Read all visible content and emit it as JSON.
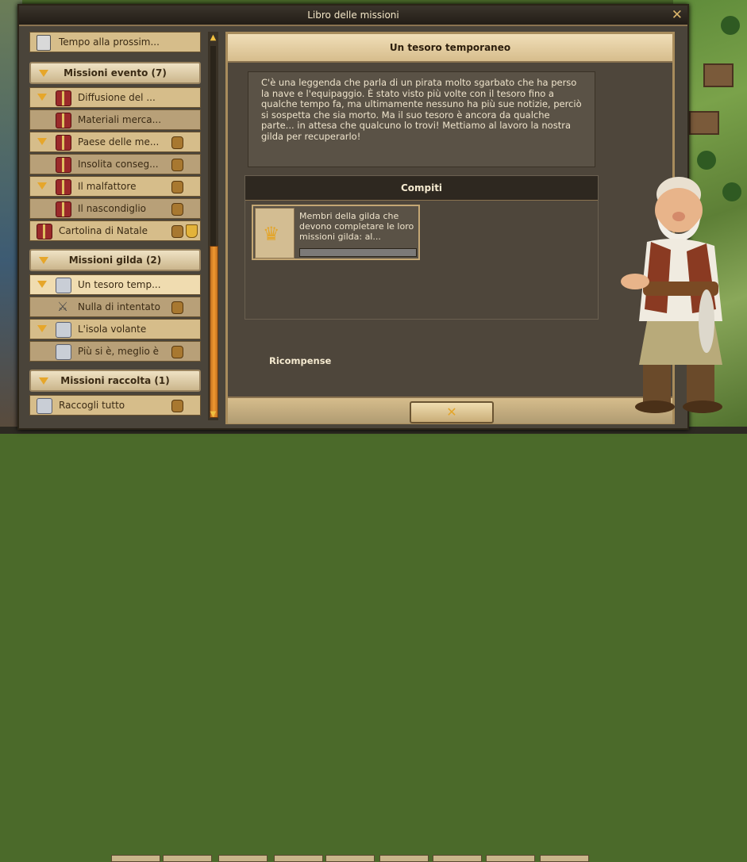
{
  "window": {
    "title": "Libro delle missioni",
    "close_icon": "close-icon"
  },
  "list": {
    "timer_row": {
      "label": "Tempo alla prossim...",
      "icon": "hourglass-icon"
    },
    "groups": [
      {
        "header": "Missioni evento (7)",
        "items": [
          {
            "label": "Diffusione del ...",
            "icon": "gift-icon",
            "expanded": true
          },
          {
            "label": "Materiali merca...",
            "icon": "gift-icon",
            "indent": true
          },
          {
            "label": "Paese delle me...",
            "icon": "gift-icon",
            "expanded": true,
            "reward": "bag-icon"
          },
          {
            "label": "Insolita conseg...",
            "icon": "gift-icon",
            "indent": true,
            "reward": "bag-icon"
          },
          {
            "label": "Il malfattore",
            "icon": "gift-icon",
            "expanded": true,
            "reward": "bag-icon"
          },
          {
            "label": "Il nascondiglio",
            "icon": "gift-icon",
            "indent": true,
            "reward": "bag-icon"
          },
          {
            "label": "Cartolina di Natale",
            "icon": "gift-icon",
            "reward": "bag-icon",
            "reward2": "cup-icon"
          }
        ]
      },
      {
        "header": "Missioni gilda (2)",
        "items": [
          {
            "label": "Un tesoro temp...",
            "icon": "scroll-icon",
            "expanded": true,
            "selected": true
          },
          {
            "label": "Nulla di intentato",
            "icon": "swords-icon",
            "indent": true,
            "reward": "bag-icon"
          },
          {
            "label": "L'isola volante",
            "icon": "scroll-icon",
            "expanded": true
          },
          {
            "label": "Più si è, meglio è",
            "icon": "scroll-icon",
            "indent": true,
            "reward": "bag-icon"
          }
        ]
      },
      {
        "header": "Missioni raccolta (1)",
        "items": [
          {
            "label": "Raccogli tutto",
            "icon": "scroll-icon",
            "reward": "bag-icon"
          }
        ]
      }
    ]
  },
  "detail": {
    "title": "Un tesoro temporaneo",
    "description": "C'è una leggenda che parla di un pirata molto sgarbato che ha perso la nave e l'equipaggio. È stato visto più volte con il tesoro fino a qualche tempo fa, ma ultimamente nessuno ha più sue notizie, perciò si sospetta che sia morto. Ma il suo tesoro è ancora da qualche parte... in attesa che qualcuno lo trovi! Mettiamo al lavoro la nostra gilda per recuperarlo!",
    "tasks_header": "Compiti",
    "task": {
      "text": "Membri della gilda che devono completare le loro missioni gilda: al...",
      "icon": "crown-icon",
      "progress": 0
    },
    "rewards_label": "Ricompense",
    "close_button_icon": "close-icon"
  },
  "colors": {
    "accent": "#e6a62a",
    "parchment": "#d6bd8a",
    "panel": "#4e463b"
  }
}
